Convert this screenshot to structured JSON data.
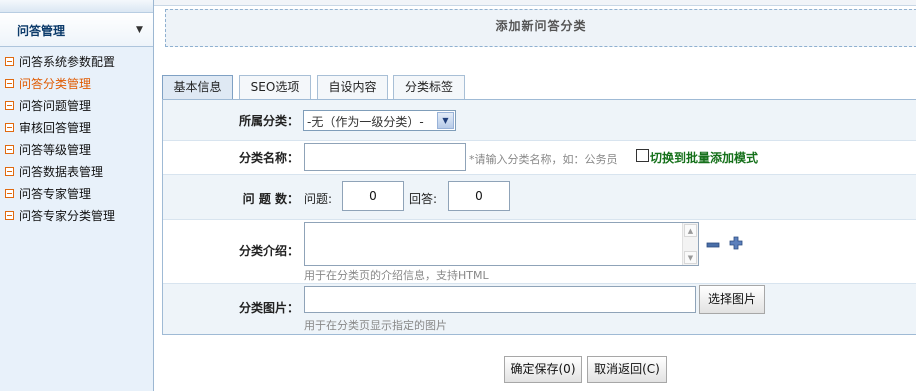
{
  "sidebar": {
    "title": "问答管理",
    "items": [
      {
        "label": "问答系统参数配置"
      },
      {
        "label": "问答分类管理"
      },
      {
        "label": "问答问题管理"
      },
      {
        "label": "审核回答管理"
      },
      {
        "label": "问答等级管理"
      },
      {
        "label": "问答数据表管理"
      },
      {
        "label": "问答专家管理"
      },
      {
        "label": "问答专家分类管理"
      }
    ],
    "active_index": 1
  },
  "page": {
    "title": "添加新问答分类"
  },
  "tabs": [
    {
      "label": "基本信息",
      "active": true
    },
    {
      "label": "SEO选项",
      "active": false
    },
    {
      "label": "自设内容",
      "active": false
    },
    {
      "label": "分类标签",
      "active": false
    }
  ],
  "form": {
    "parent": {
      "label": "所属分类：",
      "value": "-无（作为一级分类）-"
    },
    "name": {
      "label": "分类名称：",
      "value": "",
      "hint": "*请输入分类名称，如：公务员",
      "batch_link": "切换到批量添加模式"
    },
    "count": {
      "label": "问 题 数：",
      "questions_label": "问题:",
      "questions_value": "0",
      "answers_label": "回答:",
      "answers_value": "0"
    },
    "intro": {
      "label": "分类介绍：",
      "value": "",
      "hint": "用于在分类页的介绍信息，支持HTML"
    },
    "image": {
      "label": "分类图片：",
      "value": "",
      "choose_label": "选择图片",
      "hint": "用于在分类页显示指定的图片"
    }
  },
  "actions": {
    "save_label": "确定保存(0)",
    "cancel_label": "取消返回(C)"
  },
  "colors": {
    "accent_green": "#15701a",
    "active_orange": "#e05a00",
    "border_blue": "#9fbad5"
  }
}
